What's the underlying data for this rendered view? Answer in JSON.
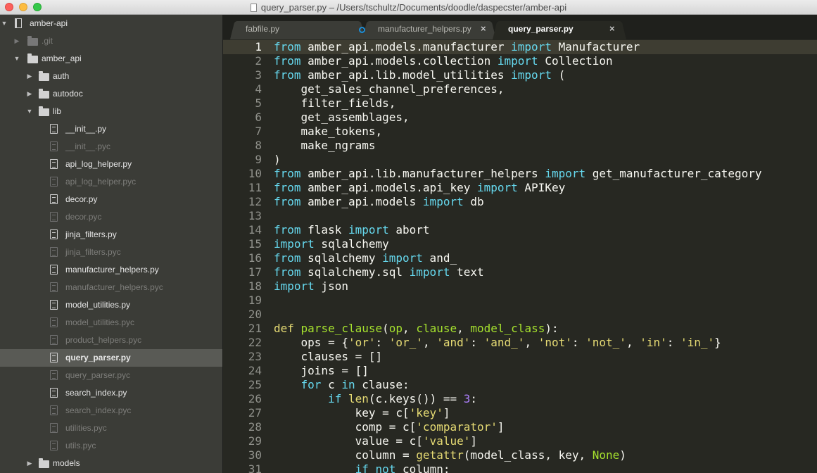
{
  "window": {
    "title": "query_parser.py – /Users/tschultz/Documents/doodle/daspecster/amber-api"
  },
  "sidebar": {
    "items": [
      {
        "label": "amber-api",
        "kind": "repo",
        "depth": 0,
        "expanded": true,
        "dim": false,
        "selected": false
      },
      {
        "label": ".git",
        "kind": "folder",
        "depth": 1,
        "expanded": false,
        "dim": true,
        "selected": false
      },
      {
        "label": "amber_api",
        "kind": "folder",
        "depth": 1,
        "expanded": true,
        "dim": false,
        "selected": false
      },
      {
        "label": "auth",
        "kind": "folder",
        "depth": 2,
        "expanded": false,
        "dim": false,
        "selected": false
      },
      {
        "label": "autodoc",
        "kind": "folder",
        "depth": 2,
        "expanded": false,
        "dim": false,
        "selected": false
      },
      {
        "label": "lib",
        "kind": "folder",
        "depth": 2,
        "expanded": true,
        "dim": false,
        "selected": false
      },
      {
        "label": "__init__.py",
        "kind": "file",
        "depth": 3,
        "dim": false,
        "selected": false
      },
      {
        "label": "__init__.pyc",
        "kind": "file",
        "depth": 3,
        "dim": true,
        "selected": false
      },
      {
        "label": "api_log_helper.py",
        "kind": "file",
        "depth": 3,
        "dim": false,
        "selected": false
      },
      {
        "label": "api_log_helper.pyc",
        "kind": "file",
        "depth": 3,
        "dim": true,
        "selected": false
      },
      {
        "label": "decor.py",
        "kind": "file",
        "depth": 3,
        "dim": false,
        "selected": false
      },
      {
        "label": "decor.pyc",
        "kind": "file",
        "depth": 3,
        "dim": true,
        "selected": false
      },
      {
        "label": "jinja_filters.py",
        "kind": "file",
        "depth": 3,
        "dim": false,
        "selected": false
      },
      {
        "label": "jinja_filters.pyc",
        "kind": "file",
        "depth": 3,
        "dim": true,
        "selected": false
      },
      {
        "label": "manufacturer_helpers.py",
        "kind": "file",
        "depth": 3,
        "dim": false,
        "selected": false
      },
      {
        "label": "manufacturer_helpers.pyc",
        "kind": "file",
        "depth": 3,
        "dim": true,
        "selected": false
      },
      {
        "label": "model_utilities.py",
        "kind": "file",
        "depth": 3,
        "dim": false,
        "selected": false
      },
      {
        "label": "model_utilities.pyc",
        "kind": "file",
        "depth": 3,
        "dim": true,
        "selected": false
      },
      {
        "label": "product_helpers.pyc",
        "kind": "file",
        "depth": 3,
        "dim": true,
        "selected": false
      },
      {
        "label": "query_parser.py",
        "kind": "file",
        "depth": 3,
        "dim": false,
        "selected": true
      },
      {
        "label": "query_parser.pyc",
        "kind": "file",
        "depth": 3,
        "dim": true,
        "selected": false
      },
      {
        "label": "search_index.py",
        "kind": "file",
        "depth": 3,
        "dim": false,
        "selected": false
      },
      {
        "label": "search_index.pyc",
        "kind": "file",
        "depth": 3,
        "dim": true,
        "selected": false
      },
      {
        "label": "utilities.pyc",
        "kind": "file",
        "depth": 3,
        "dim": true,
        "selected": false
      },
      {
        "label": "utils.pyc",
        "kind": "file",
        "depth": 3,
        "dim": true,
        "selected": false
      },
      {
        "label": "models",
        "kind": "folder",
        "depth": 2,
        "expanded": false,
        "dim": false,
        "selected": false
      }
    ]
  },
  "tabs": [
    {
      "label": "fabfile.py",
      "active": false,
      "dirty": true
    },
    {
      "label": "manufacturer_helpers.py",
      "active": false,
      "dirty": false
    },
    {
      "label": "query_parser.py",
      "active": true,
      "dirty": false
    }
  ],
  "editor": {
    "current_line": 1,
    "lines": [
      {
        "n": "1",
        "tokens": [
          [
            "k",
            "from"
          ],
          [
            "t",
            " amber_api.models.manufacturer "
          ],
          [
            "k",
            "import"
          ],
          [
            "t",
            " Manufacturer"
          ]
        ]
      },
      {
        "n": "2",
        "tokens": [
          [
            "k",
            "from"
          ],
          [
            "t",
            " amber_api.models.collection "
          ],
          [
            "k",
            "import"
          ],
          [
            "t",
            " Collection"
          ]
        ]
      },
      {
        "n": "3",
        "tokens": [
          [
            "k",
            "from"
          ],
          [
            "t",
            " amber_api.lib.model_utilities "
          ],
          [
            "k",
            "import"
          ],
          [
            "t",
            " ("
          ]
        ]
      },
      {
        "n": "4",
        "tokens": [
          [
            "t",
            "    get_sales_channel_preferences,"
          ]
        ]
      },
      {
        "n": "5",
        "tokens": [
          [
            "t",
            "    filter_fields,"
          ]
        ]
      },
      {
        "n": "6",
        "tokens": [
          [
            "t",
            "    get_assemblages,"
          ]
        ]
      },
      {
        "n": "7",
        "tokens": [
          [
            "t",
            "    make_tokens,"
          ]
        ]
      },
      {
        "n": "8",
        "tokens": [
          [
            "t",
            "    make_ngrams"
          ]
        ]
      },
      {
        "n": "9",
        "tokens": [
          [
            "t",
            ")"
          ]
        ]
      },
      {
        "n": "10",
        "tokens": [
          [
            "k",
            "from"
          ],
          [
            "t",
            " amber_api.lib.manufacturer_helpers "
          ],
          [
            "k",
            "import"
          ],
          [
            "t",
            " get_manufacturer_category"
          ]
        ]
      },
      {
        "n": "11",
        "tokens": [
          [
            "k",
            "from"
          ],
          [
            "t",
            " amber_api.models.api_key "
          ],
          [
            "k",
            "import"
          ],
          [
            "t",
            " APIKey"
          ]
        ]
      },
      {
        "n": "12",
        "tokens": [
          [
            "k",
            "from"
          ],
          [
            "t",
            " amber_api.models "
          ],
          [
            "k",
            "import"
          ],
          [
            "t",
            " db"
          ]
        ]
      },
      {
        "n": "13",
        "tokens": []
      },
      {
        "n": "14",
        "tokens": [
          [
            "k",
            "from"
          ],
          [
            "t",
            " flask "
          ],
          [
            "k",
            "import"
          ],
          [
            "t",
            " abort"
          ]
        ]
      },
      {
        "n": "15",
        "tokens": [
          [
            "k",
            "import"
          ],
          [
            "t",
            " sqlalchemy"
          ]
        ]
      },
      {
        "n": "16",
        "tokens": [
          [
            "k",
            "from"
          ],
          [
            "t",
            " sqlalchemy "
          ],
          [
            "k",
            "import"
          ],
          [
            "t",
            " and_"
          ]
        ]
      },
      {
        "n": "17",
        "tokens": [
          [
            "k",
            "from"
          ],
          [
            "t",
            " sqlalchemy.sql "
          ],
          [
            "k",
            "import"
          ],
          [
            "t",
            " text"
          ]
        ]
      },
      {
        "n": "18",
        "tokens": [
          [
            "k",
            "import"
          ],
          [
            "t",
            " json"
          ]
        ]
      },
      {
        "n": "19",
        "tokens": []
      },
      {
        "n": "20",
        "tokens": []
      },
      {
        "n": "21",
        "tokens": [
          [
            "s",
            "def"
          ],
          [
            "t",
            " "
          ],
          [
            "fn",
            "parse_clause"
          ],
          [
            "t",
            "("
          ],
          [
            "fn",
            "op"
          ],
          [
            "t",
            ", "
          ],
          [
            "fn",
            "clause"
          ],
          [
            "t",
            ", "
          ],
          [
            "fn",
            "model_class"
          ],
          [
            "t",
            "):"
          ]
        ]
      },
      {
        "n": "22",
        "tokens": [
          [
            "t",
            "    ops = {"
          ],
          [
            "s",
            "'or'"
          ],
          [
            "t",
            ": "
          ],
          [
            "s",
            "'or_'"
          ],
          [
            "t",
            ", "
          ],
          [
            "s",
            "'and'"
          ],
          [
            "t",
            ": "
          ],
          [
            "s",
            "'and_'"
          ],
          [
            "t",
            ", "
          ],
          [
            "s",
            "'not'"
          ],
          [
            "t",
            ": "
          ],
          [
            "s",
            "'not_'"
          ],
          [
            "t",
            ", "
          ],
          [
            "s",
            "'in'"
          ],
          [
            "t",
            ": "
          ],
          [
            "s",
            "'in_'"
          ],
          [
            "t",
            "}"
          ]
        ]
      },
      {
        "n": "23",
        "tokens": [
          [
            "t",
            "    clauses = []"
          ]
        ]
      },
      {
        "n": "24",
        "tokens": [
          [
            "t",
            "    joins = []"
          ]
        ]
      },
      {
        "n": "25",
        "tokens": [
          [
            "t",
            "    "
          ],
          [
            "k",
            "for"
          ],
          [
            "t",
            " c "
          ],
          [
            "k",
            "in"
          ],
          [
            "t",
            " clause:"
          ]
        ]
      },
      {
        "n": "26",
        "tokens": [
          [
            "t",
            "        "
          ],
          [
            "k",
            "if"
          ],
          [
            "t",
            " "
          ],
          [
            "s",
            "len"
          ],
          [
            "t",
            "(c.keys()) == "
          ],
          [
            "n",
            "3"
          ],
          [
            "t",
            ":"
          ]
        ]
      },
      {
        "n": "27",
        "tokens": [
          [
            "t",
            "            key = c["
          ],
          [
            "s",
            "'key'"
          ],
          [
            "t",
            "]"
          ]
        ]
      },
      {
        "n": "28",
        "tokens": [
          [
            "t",
            "            comp = c["
          ],
          [
            "s",
            "'comparator'"
          ],
          [
            "t",
            "]"
          ]
        ]
      },
      {
        "n": "29",
        "tokens": [
          [
            "t",
            "            value = c["
          ],
          [
            "s",
            "'value'"
          ],
          [
            "t",
            "]"
          ]
        ]
      },
      {
        "n": "30",
        "tokens": [
          [
            "t",
            "            column = "
          ],
          [
            "s",
            "getattr"
          ],
          [
            "t",
            "(model_class, key, "
          ],
          [
            "fn",
            "None"
          ],
          [
            "t",
            ")"
          ]
        ]
      },
      {
        "n": "31",
        "tokens": [
          [
            "t",
            "            "
          ],
          [
            "k",
            "if"
          ],
          [
            "t",
            " "
          ],
          [
            "k",
            "not"
          ],
          [
            "t",
            " column:"
          ]
        ]
      }
    ]
  },
  "colors": {
    "keyword": "#66d9ef",
    "string": "#e6db74",
    "number": "#ae81ff",
    "function": "#a6e22e",
    "text": "#f8f8f2",
    "background": "#272822",
    "sidebar": "#3b3c37"
  }
}
